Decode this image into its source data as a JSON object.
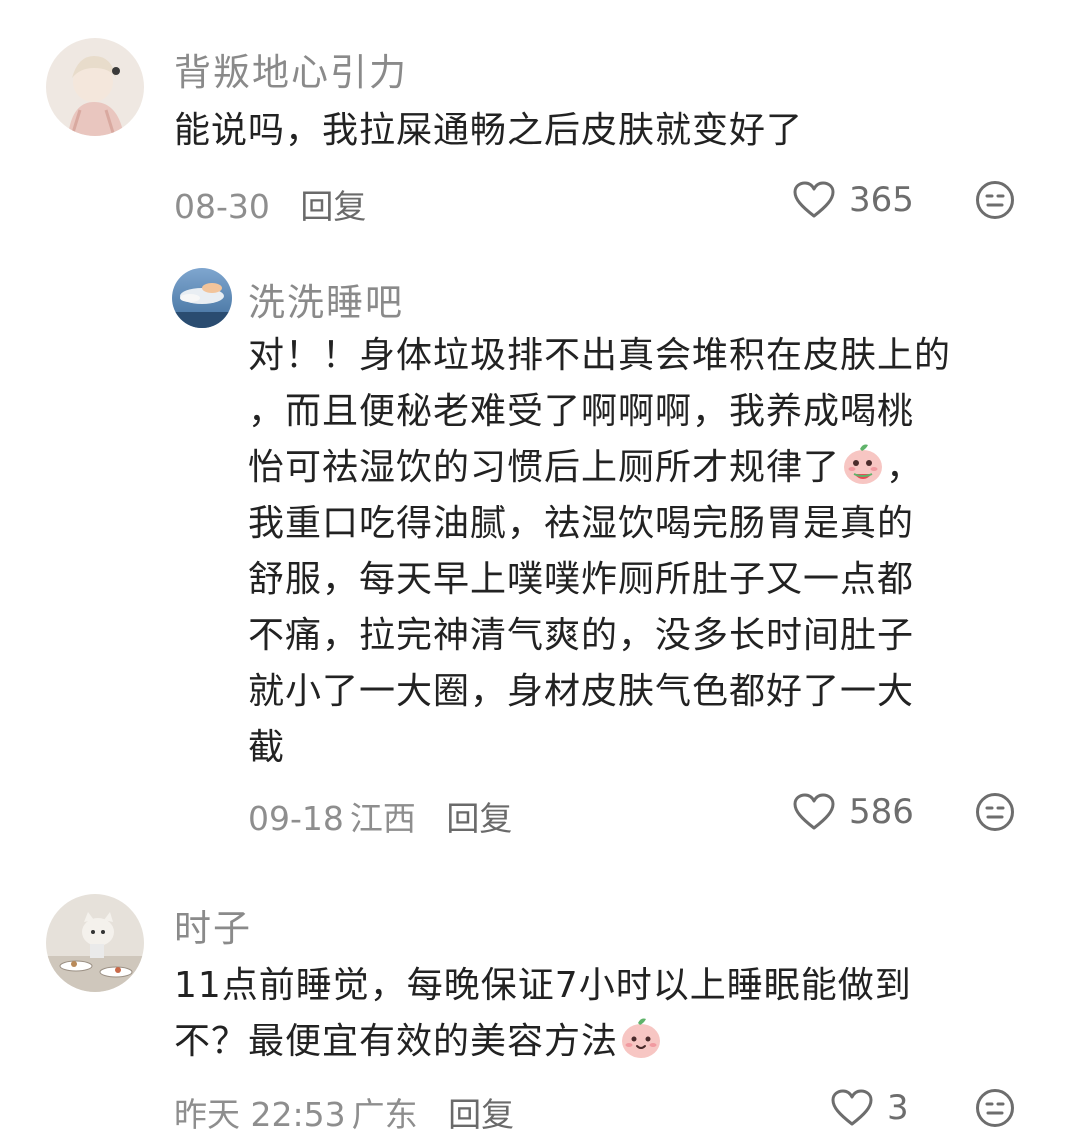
{
  "comments": [
    {
      "username": "背叛地心引力",
      "text": "能说吗，我拉屎通畅之后皮肤就变好了",
      "date": "08-30",
      "location": "",
      "reply_label": "回复",
      "likes": "365",
      "avatar_icon": "anime-character-avatar"
    },
    {
      "username": "洗洗睡吧",
      "lines": [
        "对！！身体垃圾排不出真会堆积在皮肤上的",
        "，而且便秘老难受了啊啊啊，我养成喝桃",
        "怡可祛湿饮的习惯后上厕所才规律了",
        "，",
        "我重口吃得油腻，祛湿饮喝完肠胃是真的",
        "舒服，每天早上噗噗炸厕所肚子又一点都",
        "不痛，拉完神清气爽的，没多长时间肚子",
        "就小了一大圈，身材皮肤气色都好了一大",
        "截"
      ],
      "date": "09-18",
      "location": "江西",
      "reply_label": "回复",
      "likes": "586",
      "avatar_icon": "sky-cloud-avatar",
      "sticker_icon": "peach-eating-watermelon-sticker"
    },
    {
      "username": "时子",
      "lines": [
        "11点前睡觉，每晚保证7小时以上睡眠能做到",
        "不？最便宜有效的美容方法"
      ],
      "date": "昨天 22:53",
      "location": "广东",
      "reply_label": "回复",
      "likes": "3",
      "avatar_icon": "cat-at-table-avatar",
      "sticker_icon": "peach-smile-sticker"
    }
  ],
  "icons": {
    "like": "heart-outline-icon",
    "emoji": "emoji-face-icon"
  },
  "colors": {
    "username": "#8a8a8a",
    "text": "#222222",
    "meta": "#8e8e8e"
  }
}
